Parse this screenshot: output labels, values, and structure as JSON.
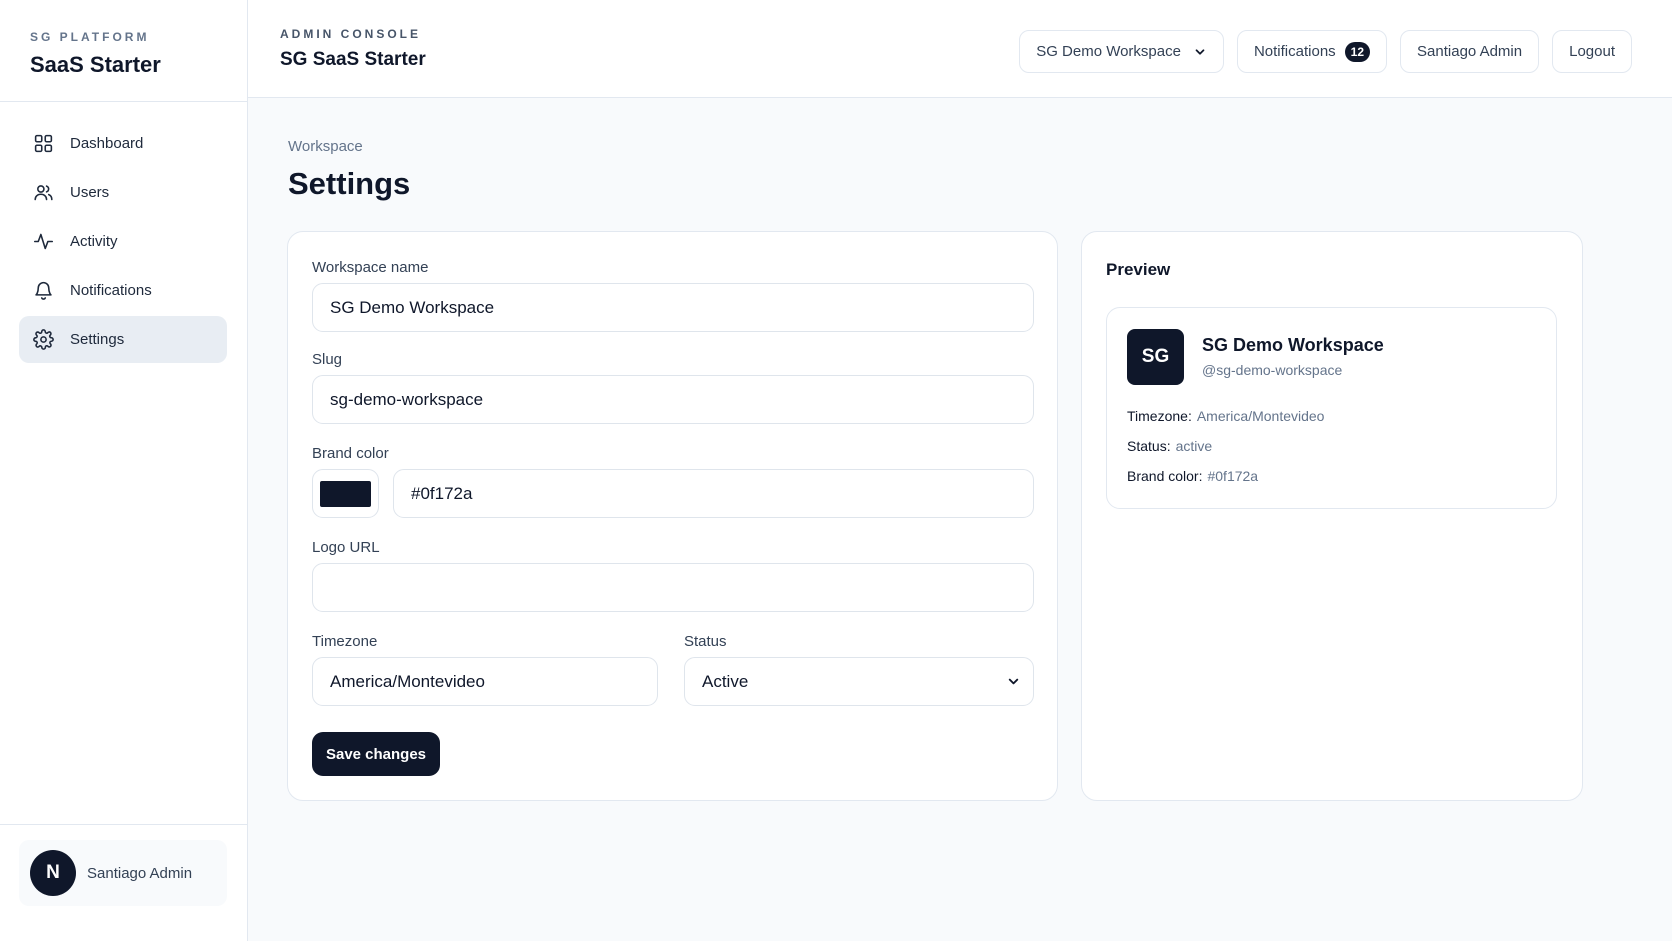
{
  "brand": {
    "kicker": "SG PLATFORM",
    "title": "SaaS Starter"
  },
  "sidebar": {
    "items": [
      {
        "label": "Dashboard",
        "icon": "dashboard-grid-icon"
      },
      {
        "label": "Users",
        "icon": "users-icon"
      },
      {
        "label": "Activity",
        "icon": "activity-icon"
      },
      {
        "label": "Notifications",
        "icon": "bell-icon"
      },
      {
        "label": "Settings",
        "icon": "gear-icon",
        "active": true
      }
    ],
    "user": {
      "initial": "N",
      "name": "Santiago Admin"
    }
  },
  "header": {
    "kicker": "ADMIN CONSOLE",
    "title": "SG SaaS Starter",
    "workspace_select": "SG Demo Workspace",
    "notifications_label": "Notifications",
    "notifications_count": "12",
    "user_label": "Santiago Admin",
    "logout_label": "Logout"
  },
  "page": {
    "breadcrumb": "Workspace",
    "title": "Settings"
  },
  "form": {
    "workspace_name": {
      "label": "Workspace name",
      "value": "SG Demo Workspace"
    },
    "slug": {
      "label": "Slug",
      "value": "sg-demo-workspace"
    },
    "brand_color": {
      "label": "Brand color",
      "value": "#0f172a"
    },
    "logo_url": {
      "label": "Logo URL",
      "value": ""
    },
    "timezone": {
      "label": "Timezone",
      "value": "America/Montevideo"
    },
    "status": {
      "label": "Status",
      "value": "Active"
    },
    "save_label": "Save changes"
  },
  "preview": {
    "title": "Preview",
    "initials": "SG",
    "name": "SG Demo Workspace",
    "slug": "@sg-demo-workspace",
    "timezone_label": "Timezone:",
    "timezone_value": "America/Montevideo",
    "status_label": "Status:",
    "status_value": "active",
    "brand_label": "Brand color:",
    "brand_value": "#0f172a"
  },
  "colors": {
    "brand": "#0f172a",
    "sidebar_active": "#e8edf3",
    "border": "#e2e8f0",
    "page_bg": "#f8fafc"
  }
}
